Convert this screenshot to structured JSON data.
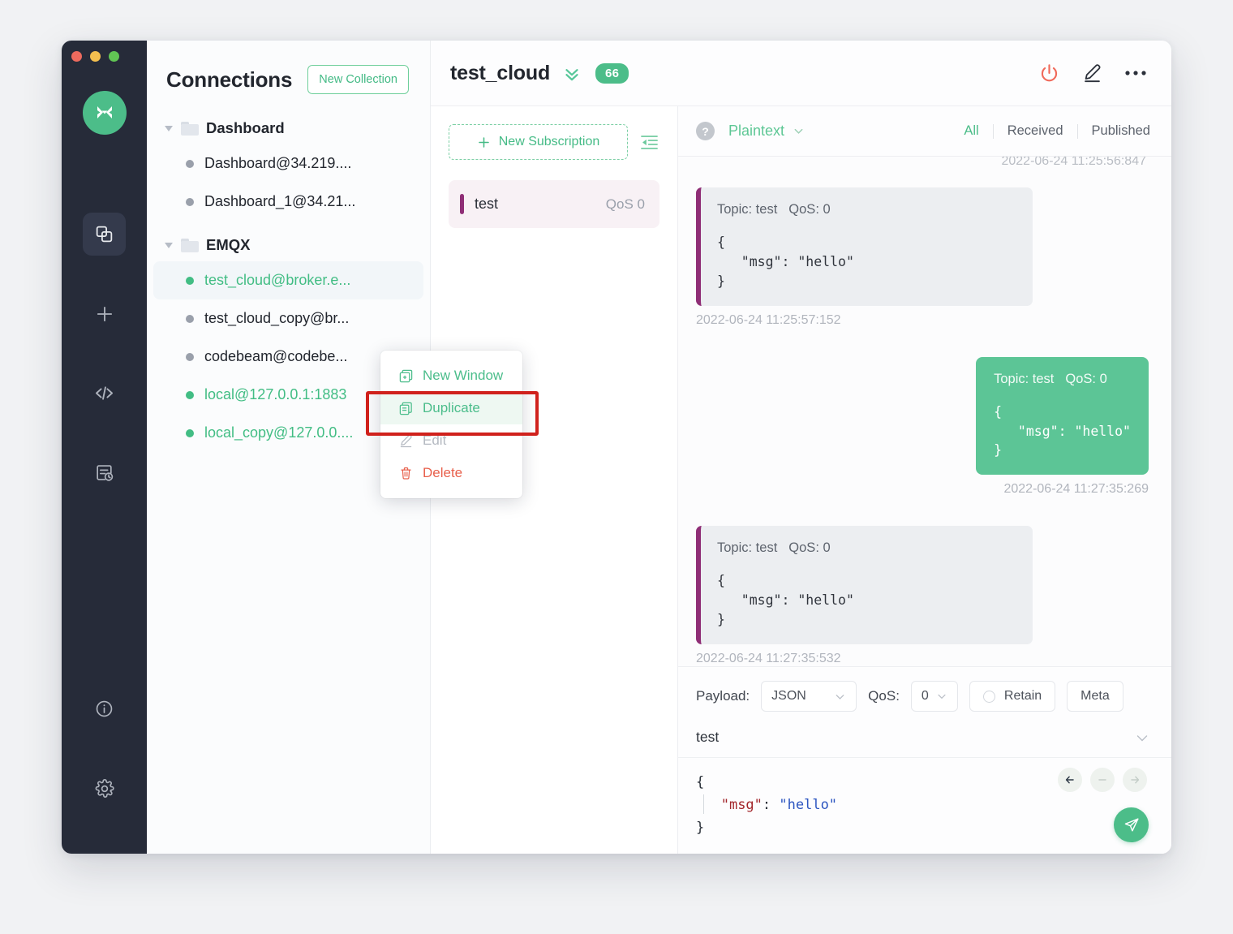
{
  "window": {
    "traffic_lights": [
      "close",
      "minimize",
      "maximize"
    ]
  },
  "activity_bar": {
    "logo": "mqttx-logo",
    "items": [
      {
        "name": "connections",
        "icon": "copy-stack-icon",
        "active": true
      },
      {
        "name": "new-connection",
        "icon": "plus-icon",
        "active": false
      },
      {
        "name": "scripts",
        "icon": "code-brackets-icon",
        "active": false
      },
      {
        "name": "log",
        "icon": "log-history-icon",
        "active": false
      }
    ],
    "bottom_items": [
      {
        "name": "about",
        "icon": "info-icon"
      },
      {
        "name": "settings",
        "icon": "gear-icon"
      }
    ]
  },
  "connections": {
    "title": "Connections",
    "new_collection_label": "New Collection",
    "groups": [
      {
        "label": "Dashboard",
        "expanded": true,
        "items": [
          {
            "label": "Dashboard@34.219....",
            "online": false,
            "selected": false
          },
          {
            "label": "Dashboard_1@34.21...",
            "online": false,
            "selected": false
          }
        ]
      },
      {
        "label": "EMQX",
        "expanded": true,
        "items": [
          {
            "label": "test_cloud@broker.e...",
            "online": true,
            "selected": true
          },
          {
            "label": "test_cloud_copy@br...",
            "online": false,
            "selected": false
          },
          {
            "label": "codebeam@codebe...",
            "online": false,
            "selected": false
          },
          {
            "label": "local@127.0.0.1:1883",
            "online": true,
            "selected": false
          },
          {
            "label": "local_copy@127.0.0....",
            "online": true,
            "selected": false
          }
        ]
      }
    ]
  },
  "context_menu": {
    "items": [
      {
        "label": "New Window",
        "icon": "new-window-icon",
        "state": "normal"
      },
      {
        "label": "Duplicate",
        "icon": "duplicate-icon",
        "state": "highlighted"
      },
      {
        "label": "Edit",
        "icon": "pencil-icon",
        "state": "disabled"
      },
      {
        "label": "Delete",
        "icon": "trash-icon",
        "state": "danger"
      }
    ],
    "highlight_color": "#d0211c"
  },
  "header": {
    "title": "test_cloud",
    "collapse_icon": "chevron-double-down-icon",
    "badge": "66",
    "actions": [
      {
        "name": "disconnect",
        "icon": "power-icon",
        "color": "#f0695a"
      },
      {
        "name": "edit-connection",
        "icon": "pencil-icon",
        "color": "#2b303a"
      },
      {
        "name": "more-options",
        "icon": "ellipsis-icon",
        "color": "#2b303a"
      }
    ]
  },
  "subscriptions": {
    "new_subscription_label": "New Subscription",
    "collapse_icon": "collapse-left-icon",
    "items": [
      {
        "topic": "test",
        "qos": "QoS 0",
        "color": "#8f2e76"
      }
    ]
  },
  "messages_toolbar": {
    "help_icon": "question-circle-icon",
    "format": "Plaintext",
    "format_chevron": "chevron-down-icon",
    "filters": [
      {
        "label": "All",
        "active": true
      },
      {
        "label": "Received",
        "active": false
      },
      {
        "label": "Published",
        "active": false
      }
    ]
  },
  "messages": {
    "clipped_top_timestamp": "2022-06-24 11:25:56:847",
    "list": [
      {
        "direction": "received",
        "topic_label": "Topic: test",
        "qos_label": "QoS: 0",
        "payload": "{\n   \"msg\": \"hello\"\n}",
        "timestamp": "2022-06-24 11:25:57:152"
      },
      {
        "direction": "published",
        "topic_label": "Topic: test",
        "qos_label": "QoS: 0",
        "payload": "{\n   \"msg\": \"hello\"\n}",
        "timestamp": "2022-06-24 11:27:35:269"
      },
      {
        "direction": "received",
        "topic_label": "Topic: test",
        "qos_label": "QoS: 0",
        "payload": "{\n   \"msg\": \"hello\"\n}",
        "timestamp": "2022-06-24 11:27:35:532"
      }
    ]
  },
  "publish": {
    "payload_label": "Payload:",
    "payload_format": "JSON",
    "qos_label": "QoS:",
    "qos_value": "0",
    "retain_label": "Retain",
    "retain_checked": false,
    "meta_label": "Meta",
    "topic_value": "test",
    "topic_chevron": "chevron-down-icon",
    "editor": {
      "line1": "{",
      "key": "\"msg\"",
      "colon": ": ",
      "value": "\"hello\"",
      "line3": "}"
    },
    "nav_buttons": [
      {
        "name": "previous-message",
        "icon": "arrow-left-icon",
        "enabled": true
      },
      {
        "name": "clear-message",
        "icon": "minus-icon",
        "enabled": false
      },
      {
        "name": "next-message",
        "icon": "arrow-right-icon",
        "enabled": false
      }
    ],
    "send_icon": "send-paper-plane-icon"
  }
}
